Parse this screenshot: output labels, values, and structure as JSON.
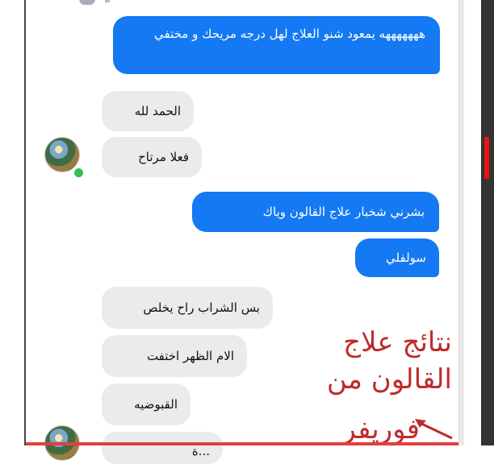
{
  "chat": {
    "messages": [
      {
        "side": "out",
        "text": "هههههههه يمعود شنو العلاج لهل درجه مريحك و مختفي"
      },
      {
        "side": "in",
        "text": "الحمد لله"
      },
      {
        "side": "in",
        "text": "فعلا مرتاح"
      },
      {
        "side": "out",
        "text": "بشرني شخبار علاج القالون وياك"
      },
      {
        "side": "out",
        "text": "سولفلي"
      },
      {
        "side": "in",
        "text": "بس الشراب راح يخلص"
      },
      {
        "side": "in",
        "text": "الام الظهر اختفت"
      },
      {
        "side": "in",
        "text": "القبوضيه"
      },
      {
        "side": "in",
        "text": "...ة"
      }
    ]
  },
  "annotation": {
    "line1": "نتائج علاج",
    "line2": "القالون من",
    "line3": "فوريفر",
    "color": "#c02a2a"
  },
  "colors": {
    "outgoing_bubble": "#1479f2",
    "incoming_bubble": "#ebebec",
    "online": "#33c24d"
  },
  "icons": [
    "contact-avatar-icon",
    "online-status-icon",
    "red-arrow-icon"
  ]
}
